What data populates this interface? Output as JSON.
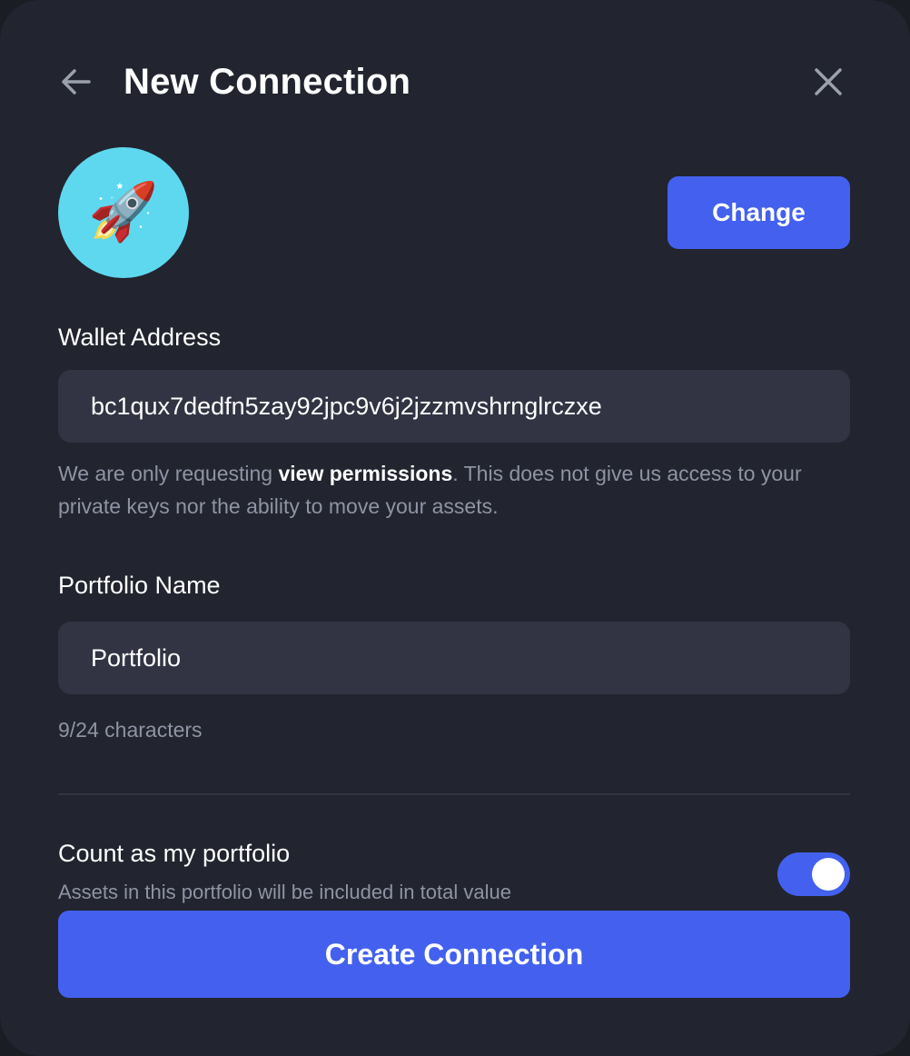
{
  "header": {
    "title": "New Connection",
    "back_icon": "arrow-left-icon",
    "close_icon": "close-icon"
  },
  "avatar": {
    "icon": "rocket-icon",
    "emoji": "🚀",
    "background": "#5ed8ef"
  },
  "change_button": {
    "label": "Change"
  },
  "wallet": {
    "label": "Wallet Address",
    "value": "bc1qux7dedfn5zay92jpc9v6j2jzzmvshrnglrczxe",
    "help_prefix": "We are only requesting ",
    "help_bold": "view permissions",
    "help_suffix": ". This does not give us access to your private keys nor the ability to move your assets."
  },
  "portfolio": {
    "label": "Portfolio Name",
    "value": "Portfolio",
    "char_count": "9/24 characters"
  },
  "count_as_portfolio": {
    "title": "Count as my portfolio",
    "subtitle": "Assets in this portfolio will be included in total value",
    "enabled": true
  },
  "create_button": {
    "label": "Create Connection"
  },
  "colors": {
    "accent": "#4361ee",
    "background": "#22242f",
    "field": "#323443",
    "muted_text": "#8f93a3"
  }
}
